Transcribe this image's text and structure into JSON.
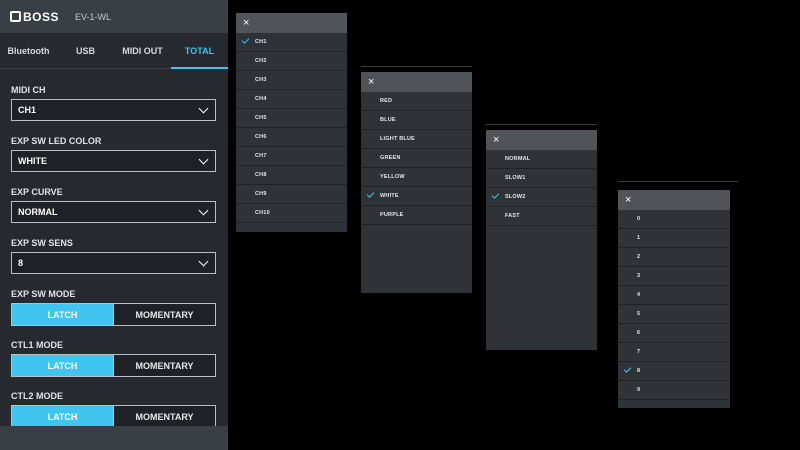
{
  "header": {
    "brand": "BOSS",
    "device": "EV-1-WL"
  },
  "tabs": [
    {
      "label": "Bluetooth",
      "active": false
    },
    {
      "label": "USB",
      "active": false
    },
    {
      "label": "MIDI OUT",
      "active": false
    },
    {
      "label": "TOTAL",
      "active": true
    }
  ],
  "settings": {
    "midi_ch": {
      "label": "MIDI CH",
      "value": "CH1"
    },
    "exp_sw_led_color": {
      "label": "EXP SW LED COLOR",
      "value": "WHITE"
    },
    "exp_curve": {
      "label": "EXP CURVE",
      "value": "NORMAL"
    },
    "exp_sw_sens": {
      "label": "EXP SW SENS",
      "value": "8"
    },
    "exp_sw_mode": {
      "label": "EXP SW MODE",
      "options": [
        "LATCH",
        "MOMENTARY"
      ],
      "selected": "LATCH"
    },
    "ctl1_mode": {
      "label": "CTL1 MODE",
      "options": [
        "LATCH",
        "MOMENTARY"
      ],
      "selected": "LATCH"
    },
    "ctl2_mode": {
      "label": "CTL2 MODE",
      "options": [
        "LATCH",
        "MOMENTARY"
      ],
      "selected": "LATCH"
    }
  },
  "popups": {
    "midi_ch": {
      "close": "×",
      "items": [
        "CH1",
        "CH2",
        "CH3",
        "CH4",
        "CH5",
        "CH6",
        "CH7",
        "CH8",
        "CH9",
        "CH10"
      ],
      "selected": "CH1"
    },
    "led_color": {
      "close": "×",
      "items": [
        "RED",
        "BLUE",
        "LIGHT BLUE",
        "GREEN",
        "YELLOW",
        "WHITE",
        "PURPLE"
      ],
      "selected": "WHITE"
    },
    "curve": {
      "close": "×",
      "items": [
        "NORMAL",
        "SLOW1",
        "SLOW2",
        "FAST"
      ],
      "selected": "SLOW2"
    },
    "sens": {
      "close": "×",
      "items": [
        "0",
        "1",
        "2",
        "3",
        "4",
        "5",
        "6",
        "7",
        "8",
        "9"
      ],
      "selected": "8"
    }
  },
  "colors": {
    "accent": "#3fc5f0",
    "panel": "#26292e",
    "header": "#3a3f45"
  }
}
